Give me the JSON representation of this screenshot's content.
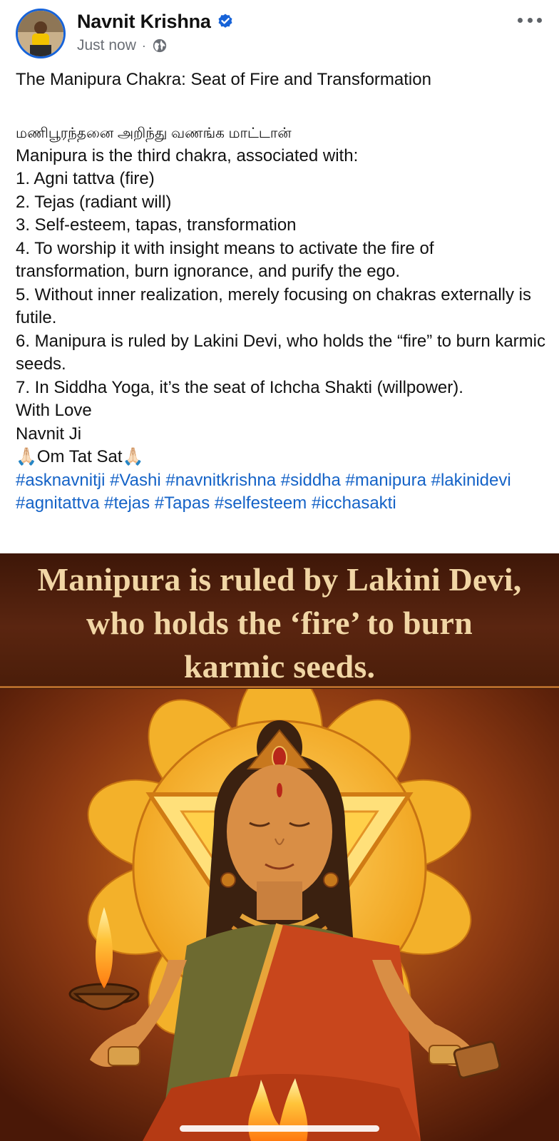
{
  "post": {
    "author": "Navnit Krishna",
    "timestamp": "Just now",
    "separator": "·",
    "title": "The Manipura Chakra: Seat of Fire and Transformation",
    "tamil_line": "மணிபூரந்தனை அறிந்து வணங்க மாட்டான்",
    "body_lines": [
      "Manipura is the third chakra, associated with:",
      "1. Agni tattva (fire)",
      "2. Tejas (radiant will)",
      "3. Self-esteem, tapas, transformation",
      "4. To worship it with insight means to activate the fire of transformation, burn ignorance, and purify the ego.",
      "5. Without inner realization, merely focusing on chakras externally is futile.",
      "6. Manipura is ruled by Lakini Devi, who holds the “fire” to burn karmic seeds.",
      "7. In Siddha Yoga, it’s the seat of Ichcha Shakti (willpower).",
      "With Love",
      "Navnit Ji",
      "🙏🏻Om Tat Sat🙏🏻"
    ],
    "hashtags": [
      "#asknavnitji",
      "#Vashi",
      "#navnitkrishna",
      "#siddha",
      "#manipura",
      "#lakinidevi",
      "#agnitattva",
      "#tejas",
      "#Tapas",
      "#selfesteem",
      "#icchasakti"
    ]
  },
  "media": {
    "caption_lines": [
      "Manipura is ruled by Lakini Devi,",
      "who holds the ‘fire’ to burn",
      "karmic seeds."
    ]
  },
  "icons": {
    "verified": "verified-badge-icon",
    "audience": "globe-icon",
    "more": "more-options-icon"
  },
  "colors": {
    "accent": "#1763d8",
    "hashtag": "#1563c7",
    "meta": "#6b6f76",
    "caption": "#f1d6a5"
  }
}
